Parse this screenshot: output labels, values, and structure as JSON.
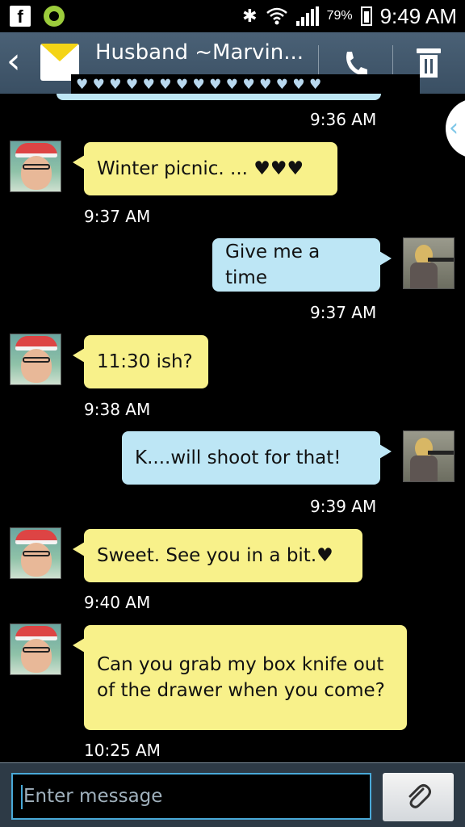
{
  "status_bar": {
    "fb_letter": "f",
    "battery_pct": "79%",
    "time": "9:49 AM",
    "icons": [
      "facebook-icon",
      "wifi-app-icon",
      "bluetooth-icon",
      "wifi-icon",
      "signal-icon",
      "battery-icon"
    ]
  },
  "header": {
    "contact_name": "Husband ~Marvin...",
    "hearts": "♥ ♥ ♥ ♥ ♥ ♥ ♥ ♥ ♥ ♥ ♥ ♥ ♥ ♥ ♥"
  },
  "messages": [
    {
      "dir": "in",
      "text": "Winter picnic. ... ♥♥♥",
      "time": "9:37 AM"
    },
    {
      "dir": "out",
      "text": "Give me a time",
      "time": "9:37 AM"
    },
    {
      "dir": "in",
      "text": "11:30 ish?",
      "time": "9:38 AM"
    },
    {
      "dir": "out",
      "text": "K....will shoot for that!",
      "time": "9:39 AM"
    },
    {
      "dir": "in",
      "text": "Sweet. See you in a bit.♥",
      "time": "9:40 AM"
    },
    {
      "dir": "in",
      "text": "Can you grab my box knife out of the drawer when you come?",
      "time": "10:25 AM"
    }
  ],
  "previous_time": "9:36 AM",
  "composer": {
    "placeholder": "Enter message"
  },
  "colors": {
    "incoming_bubble": "#f8f18a",
    "outgoing_bubble": "#bde6f5",
    "header": "#4a6176",
    "accent": "#49a9d8"
  }
}
